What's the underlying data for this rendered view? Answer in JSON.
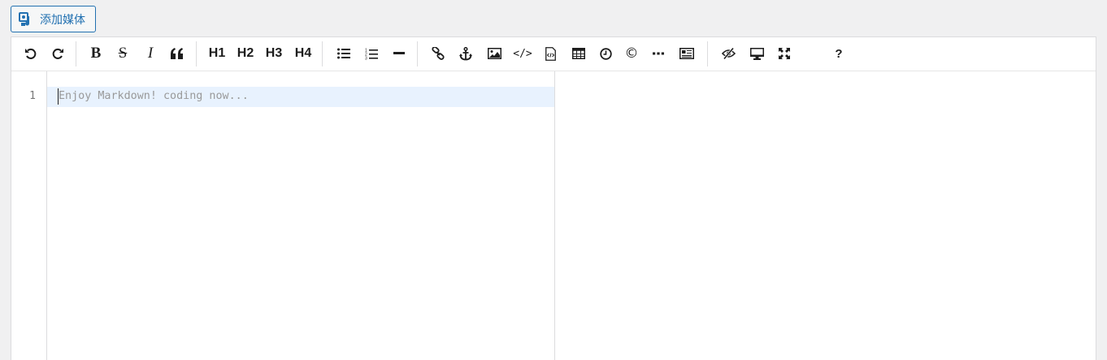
{
  "media_button": {
    "label": "添加媒体",
    "icon": "add-media-icon"
  },
  "toolbar": {
    "undo": "undo-icon",
    "redo": "redo-icon",
    "bold": "B",
    "strike": "S",
    "italic": "I",
    "quote": "quote-icon",
    "h1": "H1",
    "h2": "H2",
    "h3": "H3",
    "h4": "H4",
    "ul": "list-ul-icon",
    "ol": "list-ol-icon",
    "hr": "horizontal-rule-icon",
    "link": "link-icon",
    "anchor": "anchor-icon",
    "image": "image-icon",
    "code": "</>",
    "code_block": "code-block-icon",
    "table": "table-icon",
    "datetime": "clock-icon",
    "html_entities": "©",
    "pagebreak": "pagebreak-icon",
    "template": "template-icon",
    "watch": "eye-slash-icon",
    "preview": "desktop-icon",
    "fullscreen": "fullscreen-icon",
    "help": "?"
  },
  "editor": {
    "line_number": "1",
    "placeholder": "Enjoy Markdown! coding now..."
  }
}
